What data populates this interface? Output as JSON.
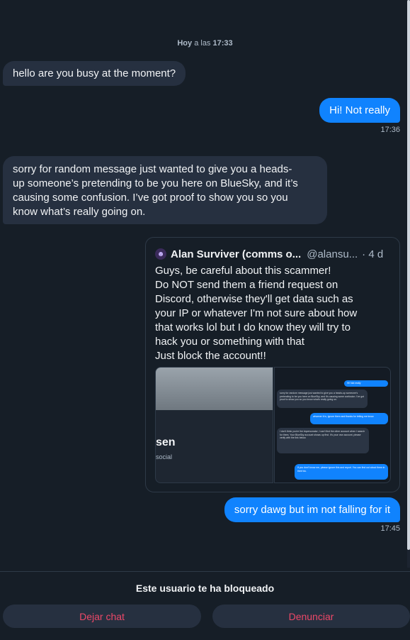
{
  "date_separator": {
    "prefix": "Hoy",
    "middle": " a las ",
    "time": "17:33"
  },
  "messages": [
    {
      "text": "hello are you busy at the moment?"
    },
    {
      "text": "Hi! Not really",
      "time": "17:36"
    },
    {
      "lines": [
        "sorry for random message just wanted to give you a heads-",
        "up someone’s pretending to be you here on BlueSky, and it’s",
        "causing some confusion. I’ve got proof to show you so you",
        "know what’s really going on."
      ]
    },
    {
      "text": "sorry dawg but im not falling for it",
      "time": "17:45"
    }
  ],
  "quote": {
    "author_name": "Alan Surviver (comms o...",
    "author_handle": "@alansu...",
    "age": "· 4 d",
    "body_lines": [
      "Guys, be careful about this scammer!",
      "Do NOT send them a friend request on",
      "Discord, otherwise they'll get data such as",
      "your IP or whatever I'm not sure about how",
      "that works lol but I do know they will try to",
      "hack you or something with that",
      "Just block the account!!"
    ],
    "profile_name_fragment": "sen",
    "profile_sub_fragment": "social",
    "screenshot_messages": [
      "hello are you busy at the moment?",
      "Hi! Not really",
      "sorry for random message just wanted to give you a heads-up someone's pretending to be you here on BlueSky, and it's causing some confusion. I've got proof to show you so you know what's really going on.",
      "whoever it is, ignore them and thanks for letting me know",
      "I don't think you're the impersonator; I can't find the other account when I search for them. Your BlueSky account shows up first. It's your own account, please verify with the link below.",
      "If you don't know me, please ignore this and report. You can find out about them in their bio."
    ]
  },
  "footer": {
    "blocked_notice": "Este usuario te ha bloqueado",
    "leave_label": "Dejar chat",
    "report_label": "Denunciar"
  }
}
